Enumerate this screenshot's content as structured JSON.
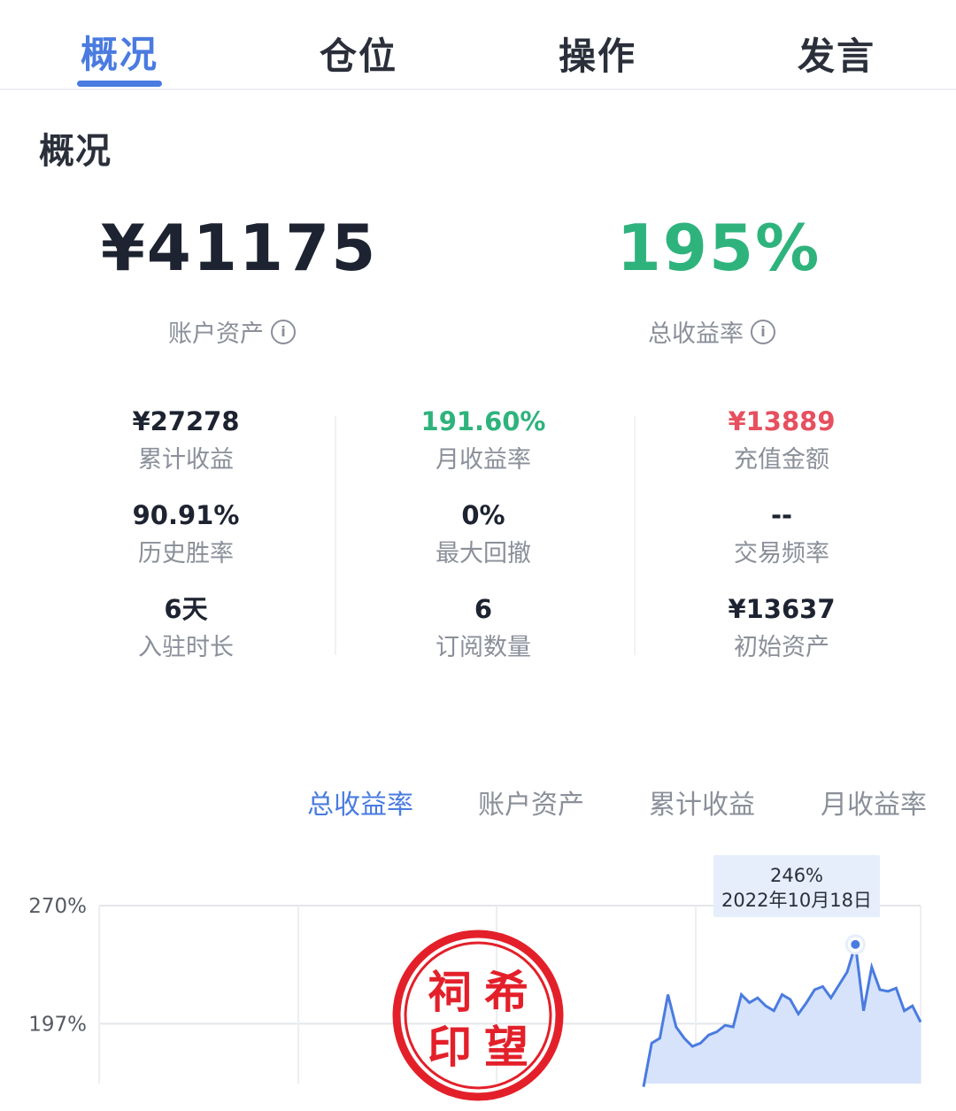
{
  "tabs": [
    {
      "label": "概况",
      "active": true
    },
    {
      "label": "仓位",
      "active": false
    },
    {
      "label": "操作",
      "active": false
    },
    {
      "label": "发言",
      "active": false
    }
  ],
  "overview": {
    "title": "概况",
    "account_assets": {
      "value": "¥41175",
      "label": "账户资产"
    },
    "total_return": {
      "value": "195%",
      "label": "总收益率"
    }
  },
  "stats": [
    {
      "value": "¥27278",
      "label": "累计收益",
      "color": "#1d2330"
    },
    {
      "value": "191.60%",
      "label": "月收益率",
      "color": "#2fb37d"
    },
    {
      "value": "¥13889",
      "label": "充值金额",
      "color": "#e6505f"
    },
    {
      "value": "90.91%",
      "label": "历史胜率",
      "color": "#1d2330"
    },
    {
      "value": "0%",
      "label": "最大回撤",
      "color": "#1d2330"
    },
    {
      "value": "--",
      "label": "交易频率",
      "color": "#1d2330"
    },
    {
      "value": "6天",
      "label": "入驻时长",
      "color": "#1d2330"
    },
    {
      "value": "6",
      "label": "订阅数量",
      "color": "#1d2330"
    },
    {
      "value": "¥13637",
      "label": "初始资产",
      "color": "#1d2330"
    }
  ],
  "chart_tabs": [
    {
      "label": "总收益率",
      "active": true
    },
    {
      "label": "账户资产",
      "active": false
    },
    {
      "label": "累计收益",
      "active": false
    },
    {
      "label": "月收益率",
      "active": false
    }
  ],
  "chart_data": {
    "type": "area",
    "ylabel": "",
    "y_ticks": [
      "270%",
      "197%"
    ],
    "y_tick_values": [
      270,
      197
    ],
    "ylim": [
      160,
      270
    ],
    "grid": true,
    "tooltip": {
      "value": "246%",
      "date": "2022年10月18日"
    },
    "series": [
      {
        "values": [
          158,
          185,
          188,
          215,
          195,
          188,
          183,
          185,
          190,
          192,
          196,
          195,
          215,
          210,
          213,
          208,
          205,
          215,
          212,
          203,
          210,
          218,
          220,
          213,
          221,
          229,
          246,
          205,
          232,
          218,
          217,
          219,
          205,
          208,
          198
        ],
        "color": "#4a7be0",
        "fill": "#d6e3fa"
      }
    ],
    "highlight_index": 26
  },
  "seal": {
    "chars": [
      "祠",
      "希",
      "印",
      "望"
    ],
    "color": "#e3202a"
  },
  "colors": {
    "accent": "#4a7be0",
    "positive": "#2fb37d",
    "negative": "#e6505f"
  }
}
